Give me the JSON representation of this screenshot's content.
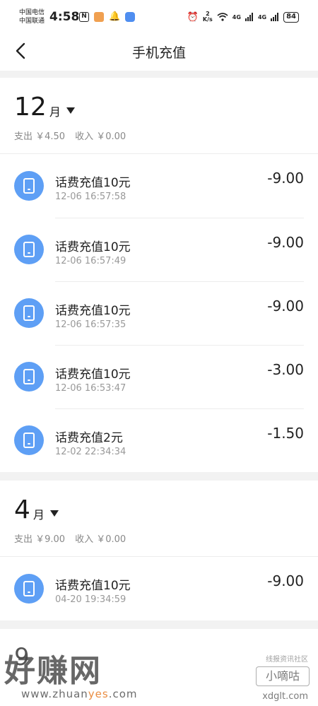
{
  "status_bar": {
    "carrier1": "中国电信",
    "carrier2": "中国联通",
    "time": "4:58",
    "nfc": "N",
    "net_speed_value": "2",
    "net_speed_unit": "K/s",
    "signal1": "4G",
    "signal2": "4G",
    "battery": "84"
  },
  "header": {
    "title": "手机充值",
    "back_icon": "chevron-left-icon"
  },
  "months": [
    {
      "month": "12",
      "unit": "月",
      "expense": "支出 ￥4.50",
      "income": "收入 ￥0.00",
      "transactions": [
        {
          "title": "话费充值10元",
          "time": "12-06 16:57:58",
          "amount": "-9.00"
        },
        {
          "title": "话费充值10元",
          "time": "12-06 16:57:49",
          "amount": "-9.00"
        },
        {
          "title": "话费充值10元",
          "time": "12-06 16:57:35",
          "amount": "-9.00"
        },
        {
          "title": "话费充值10元",
          "time": "12-06 16:53:47",
          "amount": "-3.00"
        },
        {
          "title": "话费充值2元",
          "time": "12-02 22:34:34",
          "amount": "-1.50"
        }
      ]
    },
    {
      "month": "4",
      "unit": "月",
      "expense": "支出 ￥9.00",
      "income": "收入 ￥0.00",
      "transactions": [
        {
          "title": "话费充值10元",
          "time": "04-20 19:34:59",
          "amount": "-9.00"
        }
      ]
    }
  ],
  "partial_month": "9",
  "watermark": {
    "logo": "好赚网",
    "url_a": "www.zhuan",
    "url_b": "yes",
    "url_c": ".com",
    "right_sub": "线报资讯社区",
    "right_name": "小嘀咕",
    "right_url": "xdglt.com"
  },
  "colors": {
    "accent": "#5e9ff5",
    "background": "#f2f2f2"
  }
}
